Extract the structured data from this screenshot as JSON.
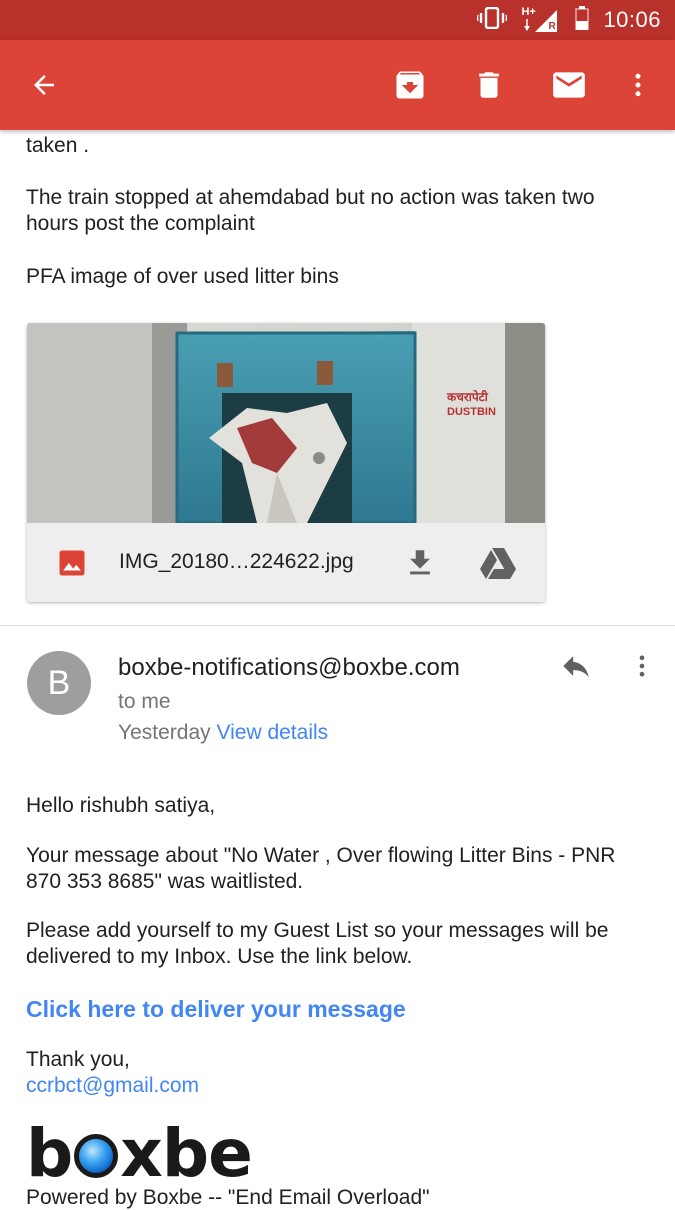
{
  "status_bar": {
    "time": "10:06",
    "network": "H+",
    "network_sub": "R"
  },
  "toolbar": {
    "back": "back-arrow",
    "archive": "archive",
    "delete": "delete",
    "mark_unread": "mail",
    "more": "more-vert"
  },
  "email1": {
    "lines": [
      "taken .",
      "The train stopped at ahemdabad but no action was taken two hours post the complaint",
      "PFA image of over used litter bins"
    ],
    "attachment": {
      "filename": "IMG_20180…224622.jpg",
      "photo_text_hindi": "कचरापेटी",
      "photo_text": "DUSTBIN"
    }
  },
  "email2": {
    "avatar_letter": "B",
    "sender": "boxbe-notifications@boxbe.com",
    "recipient": "to me",
    "date": "Yesterday",
    "view_details": "View details",
    "greeting": "Hello rishubh satiya,",
    "body1": "Your message about \"No Water , Over flowing Litter Bins - PNR 870 353 8685\" was waitlisted.",
    "body2": "Please add yourself to my Guest List so your messages will be delivered to my Inbox. Use the link below.",
    "cta": "Click here to deliver your message",
    "thanks": "Thank you,",
    "signature_email": "ccrbct@gmail.com",
    "logo_left": "b",
    "logo_right": "xbe",
    "powered": "Powered by Boxbe -- \"End Email Overload\""
  },
  "colors": {
    "appbar": "#db4437",
    "statusbar": "#b8312a",
    "link": "#4285f4"
  }
}
